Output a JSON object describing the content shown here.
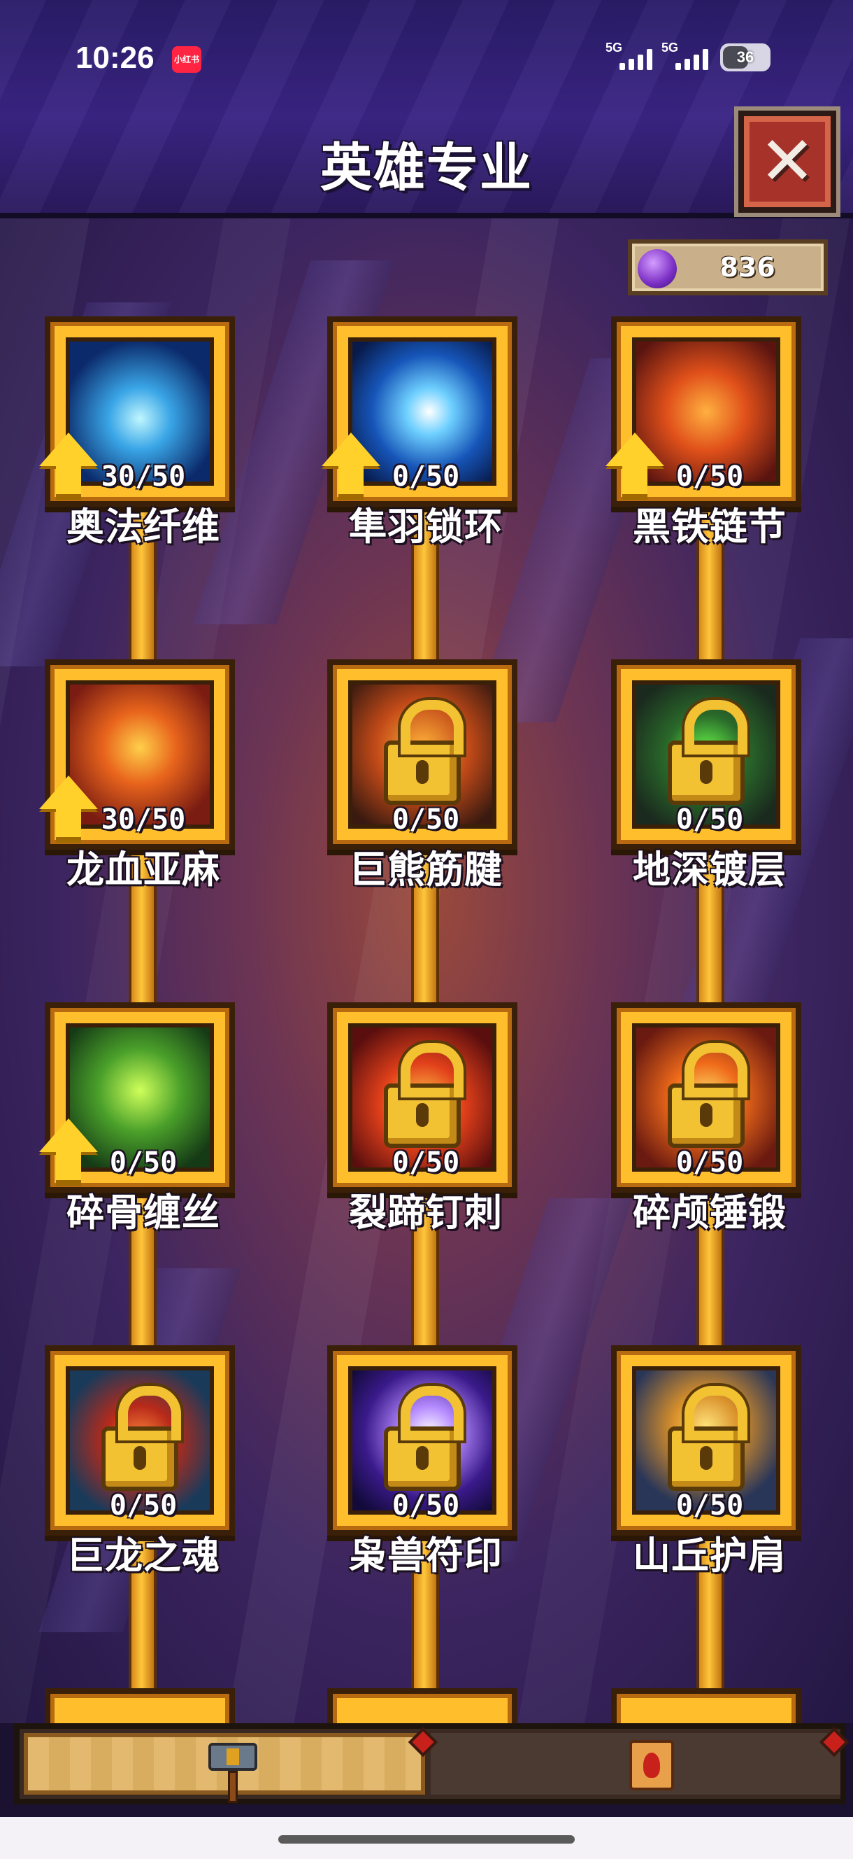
{
  "status_bar": {
    "time": "10:26",
    "app_badge": "小红书",
    "signal_1": "5G",
    "signal_2": "5G",
    "battery": "36"
  },
  "header": {
    "title": "英雄专业",
    "close_icon": "close-x-icon"
  },
  "currency": {
    "icon": "purple-gem-icon",
    "amount": "836"
  },
  "nodes": [
    {
      "name": "奥法纤维",
      "progress": "30/50",
      "upgradable": true,
      "locked": false
    },
    {
      "name": "隼羽锁环",
      "progress": "0/50",
      "upgradable": true,
      "locked": false
    },
    {
      "name": "黑铁链节",
      "progress": "0/50",
      "upgradable": true,
      "locked": false
    },
    {
      "name": "龙血亚麻",
      "progress": "30/50",
      "upgradable": true,
      "locked": false
    },
    {
      "name": "巨熊筋腱",
      "progress": "0/50",
      "upgradable": false,
      "locked": true
    },
    {
      "name": "地深镀层",
      "progress": "0/50",
      "upgradable": false,
      "locked": true
    },
    {
      "name": "碎骨缠丝",
      "progress": "0/50",
      "upgradable": true,
      "locked": false
    },
    {
      "name": "裂蹄钉刺",
      "progress": "0/50",
      "upgradable": false,
      "locked": true
    },
    {
      "name": "碎颅锤锻",
      "progress": "0/50",
      "upgradable": false,
      "locked": true
    },
    {
      "name": "巨龙之魂",
      "progress": "0/50",
      "upgradable": false,
      "locked": true
    },
    {
      "name": "枭兽符印",
      "progress": "0/50",
      "upgradable": false,
      "locked": true
    },
    {
      "name": "山丘护肩",
      "progress": "0/50",
      "upgradable": false,
      "locked": true
    }
  ],
  "tabs": [
    {
      "icon": "hammer-icon",
      "active": true
    },
    {
      "icon": "scroll-icon",
      "active": false
    }
  ]
}
